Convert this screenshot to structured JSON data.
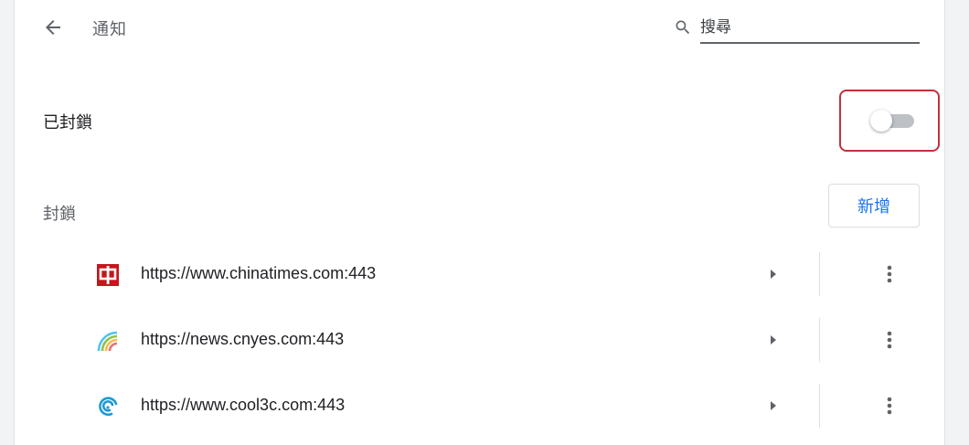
{
  "header": {
    "title": "通知",
    "search_placeholder": "搜尋"
  },
  "blocked_toggle": {
    "label": "已封鎖",
    "enabled": false
  },
  "block_section": {
    "label": "封鎖",
    "add_button_label": "新增"
  },
  "sites": [
    {
      "url": "https://www.chinatimes.com:443",
      "favicon": "chinatimes-icon"
    },
    {
      "url": "https://news.cnyes.com:443",
      "favicon": "cnyes-icon"
    },
    {
      "url": "https://www.cool3c.com:443",
      "favicon": "cool3c-icon"
    }
  ],
  "colors": {
    "accent": "#1a73e8",
    "highlight_border": "#c5303a",
    "toggle_off_track": "#bdc1c6"
  }
}
